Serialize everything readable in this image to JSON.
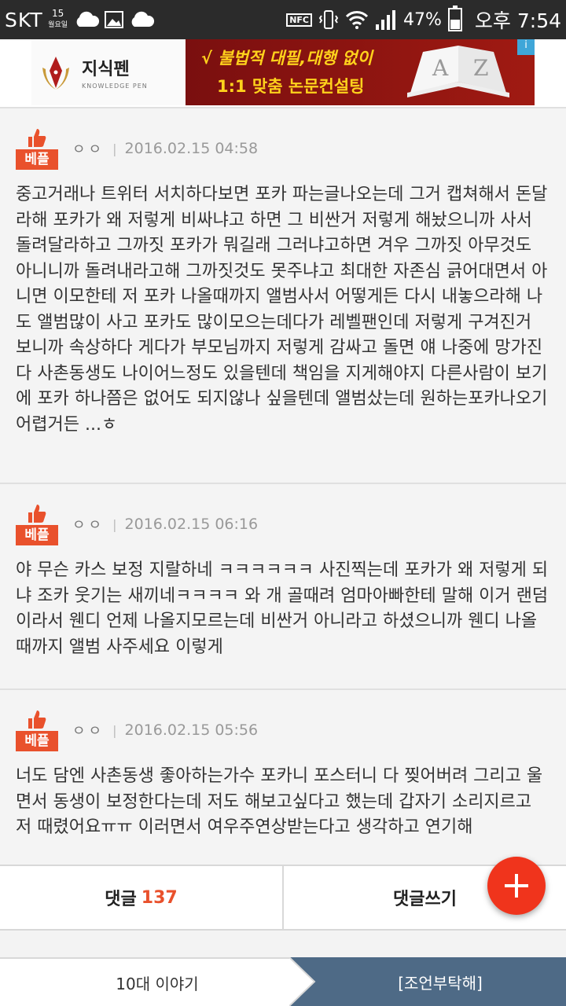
{
  "status": {
    "carrier": "SKT",
    "date_day": "15",
    "date_weekday": "월요일",
    "nfc": "NFC",
    "battery_pct": "47%",
    "battery_level": 0.47,
    "ampm": "오후",
    "time": "7:54"
  },
  "ad": {
    "brand_ko": "지식펜",
    "brand_en": "KNOWLEDGE PEN",
    "line1": "√ 불법적 대필,대행 없이",
    "line2": "1:1 맞춤 논문컨설팅",
    "info": "i"
  },
  "comments": [
    {
      "badge": "베플",
      "author": "ㅇㅇ",
      "date": "2016.02.15 04:58",
      "body": "중고거래나 트위터 서치하다보면 포카 파는글나오는데 그거 캡쳐해서 돈달라해 포카가 왜 저렇게 비싸냐고 하면 그 비싼거 저렇게 해놨으니까 사서 돌려달라하고 그까짓 포카가 뭐길래 그러냐고하면 겨우 그까짓 아무것도 아니니까 돌려내라고해 그까짓것도 못주냐고 최대한 자존심 긁어대면서 아니면 이모한테 저 포카 나올때까지 앨범사서 어떻게든 다시 내놓으라해 나도 앨범많이 사고 포카도 많이모으는데다가 레벨팬인데 저렇게 구겨진거 보니까 속상하다 게다가 부모님까지 저렇게 감싸고 돌면 얘 나중에 망가진다 사촌동생도 나이어느정도 있을텐데 책임을 지게해야지 다른사람이 보기에 포카 하나쯤은 없어도 되지않나 싶을텐데 앨범샀는데 원하는포카나오기어렵거든 ...ㅎ"
    },
    {
      "badge": "베플",
      "author": "ㅇㅇ",
      "date": "2016.02.15 06:16",
      "body": "야 무슨 카스 보정 지랄하네 ㅋㅋㅋㅋㅋㅋ 사진찍는데 포카가 왜 저렇게 되냐 조카 웃기는 새끼네ㅋㅋㅋㅋ 와 개 골때려 엄마아빠한테 말해 이거 랜덤이라서 웬디 언제 나올지모르는데 비싼거 아니라고 하셨으니까 웬디 나올때까지 앨범 사주세요 이렇게"
    },
    {
      "badge": "베플",
      "author": "ㅇㅇ",
      "date": "2016.02.15 05:56",
      "body": "너도 담엔 사촌동생 좋아하는가수 포카니 포스터니 다 찢어버려 그리고 울면서 동생이 보정한다는데 저도 해보고싶다고 했는데 갑자기 소리지르고 저 때렸어요ㅠㅠ 이러면서 여우주연상받는다고 생각하고 연기해"
    }
  ],
  "actions": {
    "comments_label": "댓글",
    "comments_count": "137",
    "write_label": "댓글쓰기"
  },
  "fab": {
    "icon": "plus-icon"
  },
  "breadcrumb": {
    "category": "10대 이야기",
    "current": "[조언부탁해]"
  },
  "colors": {
    "accent": "#e9512c",
    "fab": "#f0341c",
    "breadcrumb_active": "#4e6a86",
    "status_bar": "#2b2b2b"
  }
}
